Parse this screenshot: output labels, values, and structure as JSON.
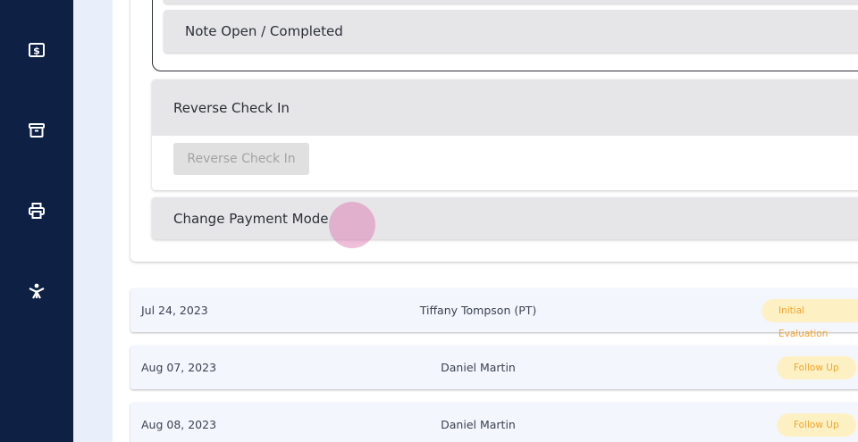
{
  "sidebar": {
    "icons": [
      {
        "name": "billing-icon"
      },
      {
        "name": "archive-icon"
      },
      {
        "name": "printer-icon"
      },
      {
        "name": "accessibility-icon"
      }
    ]
  },
  "note_section": {
    "label": "Note Open / Completed"
  },
  "reverse_check_in": {
    "header": "Reverse Check In",
    "button_label": "Reverse Check In"
  },
  "payment": {
    "header": "Change Payment Mode"
  },
  "visits": [
    {
      "date": "Jul 24, 2023",
      "provider": "Tiffany Tompson (PT)",
      "type": "Initial Evaluation"
    },
    {
      "date": "Aug 07, 2023",
      "provider": "Daniel Martin",
      "type": "Follow Up"
    },
    {
      "date": "Aug 08, 2023",
      "provider": "Daniel Martin",
      "type": "Follow Up"
    }
  ],
  "colors": {
    "sidebar_bg": "#0e2145",
    "badge_bg": "#fdf1c4",
    "badge_text": "#f0a530",
    "row_bg": "#f3f6fd"
  }
}
